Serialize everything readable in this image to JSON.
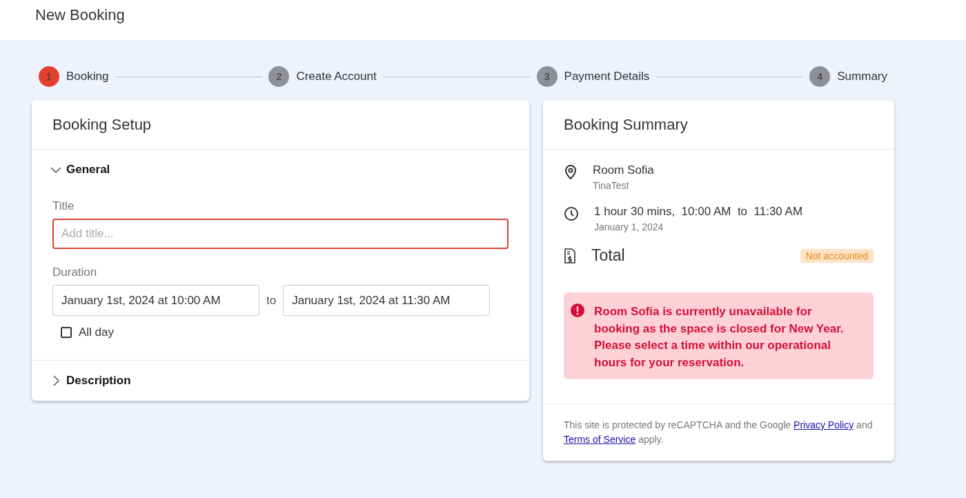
{
  "header": {
    "title": "New Booking"
  },
  "steps": [
    {
      "number": "1",
      "label": "Booking",
      "selected": true
    },
    {
      "number": "2",
      "label": "Create Account",
      "selected": false
    },
    {
      "number": "3",
      "label": "Payment Details",
      "selected": false
    },
    {
      "number": "4",
      "label": "Summary",
      "selected": false
    }
  ],
  "setup": {
    "title": "Booking Setup",
    "sections": [
      {
        "title": "General",
        "expanded": true
      },
      {
        "title": "Description",
        "expanded": false
      }
    ],
    "title_field": {
      "label": "Title",
      "placeholder": "Add title...",
      "invalid": true
    },
    "duration": {
      "label": "Duration",
      "start": "January 1st, 2024 at 10:00 AM",
      "separator": "to",
      "end": "January 1st, 2024 at 11:30 AM"
    },
    "all_day": {
      "label": "All day",
      "checked": false
    }
  },
  "summary": {
    "title": "Booking Summary",
    "location": {
      "name": "Room Sofia",
      "sub": "TinaTest"
    },
    "time": {
      "duration": "1 hour 30 mins,",
      "start": "10:00 AM",
      "separator": "to",
      "end": "11:30 AM",
      "date": "January 1, 2024"
    },
    "total": {
      "label": "Total",
      "badge": "Not accounted"
    },
    "alert": "Room Sofia is currently unavailable for booking as the space is closed for New Year. Please select a time within our operational hours for your reservation.",
    "recaptcha": {
      "before": "This site is protected by reCAPTCHA and the Google",
      "privacy_link": "Privacy Policy",
      "middle": "and",
      "terms_link": "Terms of Service",
      "after": "apply."
    }
  }
}
